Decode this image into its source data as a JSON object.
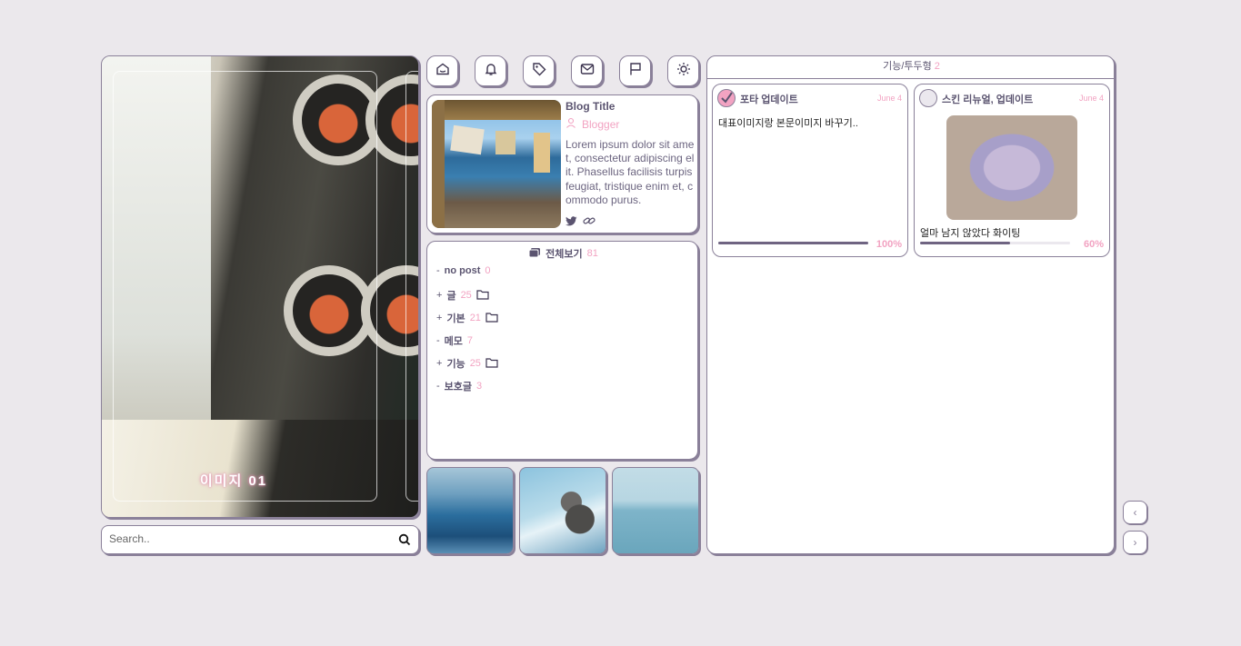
{
  "hero": {
    "caption": "이미지 01"
  },
  "search": {
    "placeholder": "Search.."
  },
  "toolbar": {
    "icons": [
      "home-icon",
      "bell-icon",
      "tag-icon",
      "mail-icon",
      "flag-icon",
      "sun-icon"
    ]
  },
  "blog": {
    "title": "Blog Title",
    "author": "Blogger",
    "description": "Lorem ipsum dolor sit amet, consectetur adipiscing elit. Phasellus facilisis turpis feugiat, tristique enim et, commodo purus."
  },
  "categories": {
    "header": "전체보기",
    "header_count": "81",
    "items": [
      {
        "prefix": "-",
        "label": "no post",
        "count": "0",
        "folder": false
      },
      {
        "prefix": "+",
        "label": "글",
        "count": "25",
        "folder": true
      },
      {
        "prefix": "+",
        "label": "기본",
        "count": "21",
        "folder": true
      },
      {
        "prefix": "-",
        "label": "메모",
        "count": "7",
        "folder": false
      },
      {
        "prefix": "+",
        "label": "기능",
        "count": "25",
        "folder": true
      },
      {
        "prefix": "-",
        "label": "보호글",
        "count": "3",
        "folder": false
      }
    ]
  },
  "board": {
    "title": "기능/투두형",
    "count": "2",
    "todos": [
      {
        "title": "포타 업데이트",
        "date": "June 4",
        "body": "대표이미지랑 본문이미지 바꾸기..",
        "progress": 1.0,
        "progress_label": "100%",
        "checked": true
      },
      {
        "title": "스킨 리뉴얼, 업데이트",
        "date": "June 4",
        "body": "얼마 남지 않았다 화이팅",
        "progress": 0.6,
        "progress_label": "60%",
        "checked": false
      }
    ]
  },
  "pager": {
    "prev": "‹",
    "next": "›"
  },
  "colors": {
    "accent": "#f2a3c2",
    "border": "#8a8099",
    "text": "#5b5470",
    "background": "#ebe8ec"
  }
}
